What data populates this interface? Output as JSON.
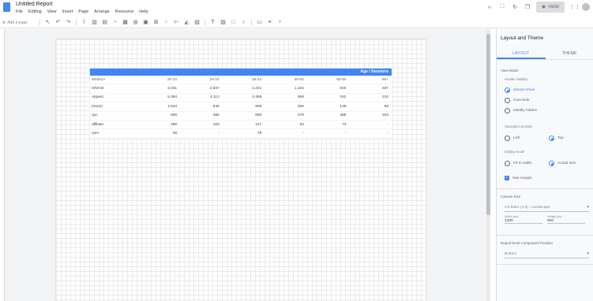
{
  "app": {
    "doc_title": "Untitled Report"
  },
  "menu": [
    "File",
    "Editing",
    "View",
    "Insert",
    "Page",
    "Arrange",
    "Resource",
    "Help"
  ],
  "header": {
    "view_label": "VIEW"
  },
  "toolbar": {
    "add_page_label": "Add a page"
  },
  "table": {
    "header_band": "Age / Sessions",
    "columns": [
      "Medium",
      "25-34",
      "18-24",
      "35-44",
      "45-54",
      "55-64",
      "65+"
    ],
    "rows": [
      [
        "referral",
        "3,341",
        "2,937",
        "2,231",
        "1,224",
        "620",
        "487"
      ],
      [
        "organic",
        "5,394",
        "4,113",
        "2,455",
        "959",
        "342",
        "210"
      ],
      [
        "(none)",
        "1,643",
        "848",
        "905",
        "256",
        "128",
        "88"
      ],
      [
        "cpc",
        "608",
        "486",
        "658",
        "479",
        "488",
        "334"
      ],
      [
        "affiliate",
        "296",
        "183",
        "127",
        "83",
        "74",
        "-"
      ],
      [
        "cpm",
        "28",
        "-",
        "78",
        "-",
        "-",
        "-"
      ]
    ]
  },
  "panel": {
    "title": "Layout and Theme",
    "tabs": [
      "LAYOUT",
      "THEME"
    ],
    "view_mode_label": "View Mode",
    "header_visibility_label": "Header visibility",
    "header_options": [
      "always show",
      "Auto-hide",
      "Initially hidden"
    ],
    "nav_position_label": "Navigation position",
    "nav_options": [
      "Left",
      "Top"
    ],
    "display_mode_label": "Display mode",
    "display_options": [
      "Fit to width",
      "Actual size"
    ],
    "has_margin_label": "Has margin",
    "canvas_size_label": "Canvas Size",
    "canvas_size_value": "US letter (4:3) - Landscape",
    "width_label": "Width (px)",
    "width_value": "1200",
    "height_label": "Height (px)",
    "height_value": "900",
    "component_position_label": "Report-level Component Position",
    "component_position_value": "Bottom"
  }
}
